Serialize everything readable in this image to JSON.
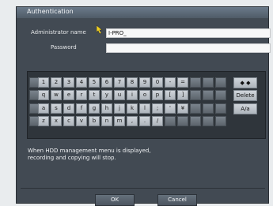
{
  "dialog": {
    "title": "Authentication",
    "admin_label": "Administrator name",
    "admin_value": "I-PRO_",
    "password_label": "Password",
    "password_value": ""
  },
  "keyboard": {
    "rows": [
      [
        "1",
        "2",
        "3",
        "4",
        "5",
        "6",
        "7",
        "8",
        "9",
        "0",
        "-",
        "="
      ],
      [
        "q",
        "w",
        "e",
        "r",
        "t",
        "y",
        "u",
        "i",
        "o",
        "p",
        "[",
        "]"
      ],
      [
        "a",
        "s",
        "d",
        "f",
        "g",
        "h",
        "j",
        "k",
        "l",
        ";",
        "'",
        "¥"
      ],
      [
        "z",
        "x",
        "c",
        "v",
        "b",
        "n",
        "m",
        ",",
        ".",
        "/"
      ]
    ],
    "side": {
      "cursor_keys": "◆ ◆",
      "delete": "Delete",
      "case_toggle": "A/a"
    }
  },
  "message": {
    "line1": "When HDD management menu is displayed,",
    "line2": "recording and copying will stop."
  },
  "buttons": {
    "ok": "OK",
    "cancel": "Cancel"
  }
}
